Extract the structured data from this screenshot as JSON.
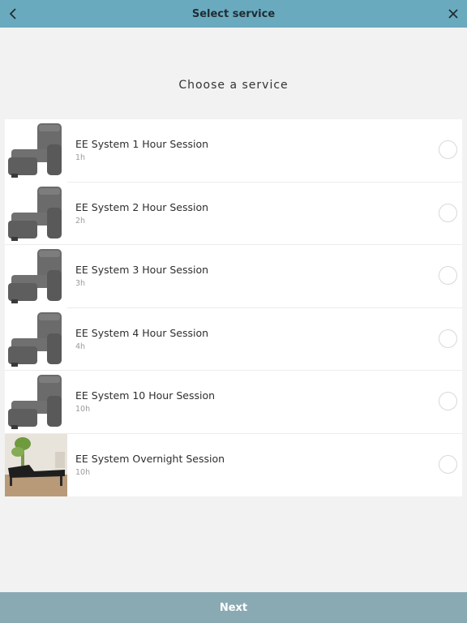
{
  "header": {
    "title": "Select service",
    "back_icon": "chevron-left-icon",
    "close_icon": "close-icon",
    "bg_color": "#6aaabf"
  },
  "main": {
    "heading": "Choose a service",
    "services": [
      {
        "name": "EE System 1 Hour Session",
        "duration": "1h",
        "image": "recliner-chair"
      },
      {
        "name": "EE System 2 Hour Session",
        "duration": "2h",
        "image": "recliner-chair"
      },
      {
        "name": "EE System 3 Hour Session",
        "duration": "3h",
        "image": "recliner-chair"
      },
      {
        "name": "EE System 4 Hour Session",
        "duration": "4h",
        "image": "recliner-chair"
      },
      {
        "name": "EE System 10 Hour Session",
        "duration": "10h",
        "image": "recliner-chair"
      },
      {
        "name": "EE System Overnight Session",
        "duration": "10h",
        "image": "adjustable-bed"
      }
    ]
  },
  "footer": {
    "next_label": "Next",
    "bg_color": "#8aaab3"
  }
}
